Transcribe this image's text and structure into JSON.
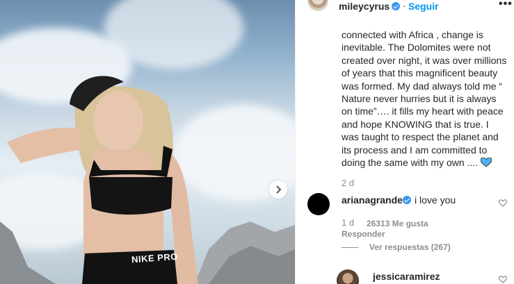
{
  "post": {
    "username": "mileycyrus",
    "follow_label": "Seguir",
    "more_label": "•••",
    "caption": "connected with Africa , change is inevitable. The Dolomites were not created over night, it was over millions of years that this magnificent beauty was formed. My dad always told me “ Nature never hurries but it is always on time”…. it fills my heart with peace and hope KNOWING that is true. I was taught to respect the planet and its process and I am committed to doing the same with my own ....",
    "caption_emoji": "blue-heart-icon",
    "time": "2 d"
  },
  "photo": {
    "shorts_text": "NIKE PRO",
    "next_icon": "chevron-right-icon"
  },
  "comments": [
    {
      "username": "arianagrande",
      "text": "i love you",
      "time": "1 d",
      "likes": "26313 Me gusta",
      "reply_label": "Responder",
      "view_replies": "Ver respuestas (267)"
    },
    {
      "username": "jessicaramirez"
    }
  ],
  "colors": {
    "link_blue": "#0095f6",
    "verified_blue": "#3897f0",
    "muted": "#8e8e8e",
    "text": "#262626",
    "heart_blue": "#4fb5ee"
  }
}
